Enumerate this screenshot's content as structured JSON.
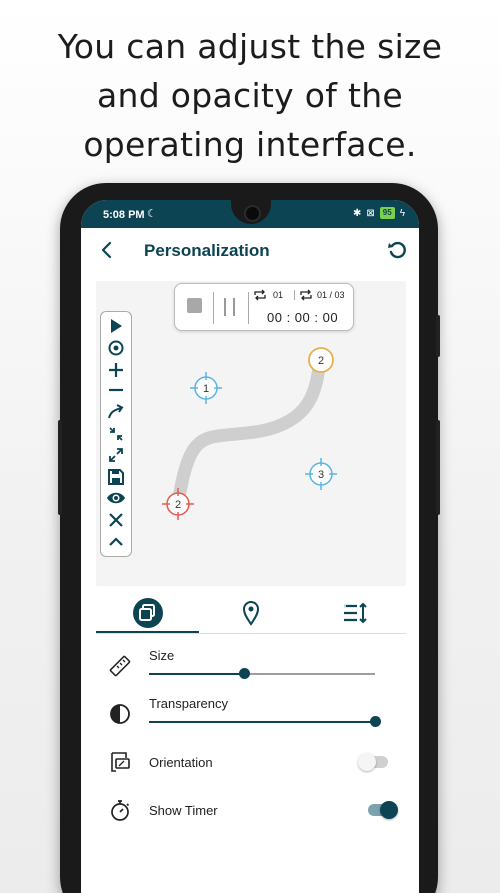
{
  "headline": {
    "line1": "You can adjust the size",
    "line2": "and opacity of the",
    "line3": "operating interface."
  },
  "statusbar": {
    "time": "5:08 PM",
    "icons": [
      "moon-icon",
      "bluetooth-icon",
      "no-sim-icon",
      "battery-icon",
      "charging-icon"
    ],
    "battery": "95"
  },
  "appbar": {
    "title": "Personalization",
    "back_icon": "back-arrow-icon",
    "reset_icon": "reset-icon"
  },
  "timer_panel": {
    "loop_count": "01",
    "repeat_count": "01 / 03",
    "elapsed": "00 : 00 : 00"
  },
  "toolbar": {
    "tools": [
      "play-icon",
      "target-icon",
      "plus-icon",
      "minus-icon",
      "swipe-icon",
      "collapse-icon",
      "expand-icon",
      "save-icon",
      "eye-icon",
      "close-icon",
      "chevron-up-icon"
    ]
  },
  "preview_targets": [
    {
      "label": "1",
      "color": "#5ab4e6"
    },
    {
      "label": "2",
      "color": "#e8b04a"
    },
    {
      "label": "3",
      "color": "#5ab4e6"
    },
    {
      "label": "2",
      "color": "#e65a4a"
    }
  ],
  "tabs": [
    {
      "name": "layers",
      "icon": "layers-icon",
      "active": true
    },
    {
      "name": "location",
      "icon": "location-pin-icon",
      "active": false
    },
    {
      "name": "options",
      "icon": "sort-list-icon",
      "active": false
    }
  ],
  "settings": {
    "size": {
      "label": "Size",
      "value_fraction": 0.42
    },
    "transparency": {
      "label": "Transparency",
      "value_fraction": 1.0
    },
    "orientation": {
      "label": "Orientation",
      "enabled": false
    },
    "show_timer": {
      "label": "Show Timer",
      "enabled": true
    }
  },
  "colors": {
    "primary": "#0c4453",
    "battery": "#7bd14a"
  }
}
